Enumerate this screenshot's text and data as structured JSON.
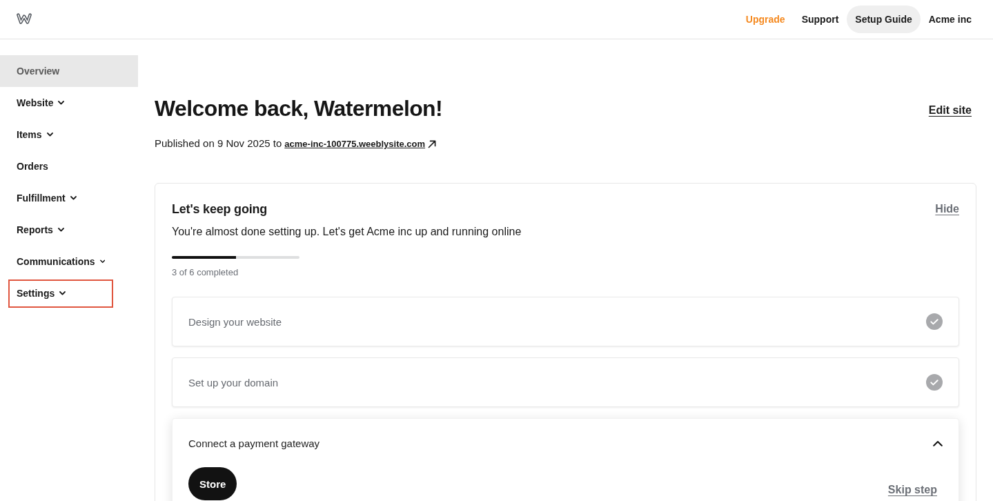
{
  "header": {
    "nav": [
      {
        "label": "Upgrade",
        "kind": "upgrade"
      },
      {
        "label": "Support",
        "kind": "plain"
      },
      {
        "label": "Setup Guide",
        "kind": "pill"
      },
      {
        "label": "Acme inc",
        "kind": "account"
      }
    ]
  },
  "sidebar": {
    "items": [
      {
        "label": "Overview",
        "kind": "link",
        "selected": true,
        "highlighted": false
      },
      {
        "label": "Website",
        "kind": "menu",
        "selected": false,
        "highlighted": false
      },
      {
        "label": "Items",
        "kind": "menu",
        "selected": false,
        "highlighted": false
      },
      {
        "label": "Orders",
        "kind": "link",
        "selected": false,
        "highlighted": false
      },
      {
        "label": "Fulfillment",
        "kind": "menu",
        "selected": false,
        "highlighted": false
      },
      {
        "label": "Reports",
        "kind": "menu",
        "selected": false,
        "highlighted": false
      },
      {
        "label": "Communications",
        "kind": "menu",
        "selected": false,
        "highlighted": false
      },
      {
        "label": "Settings",
        "kind": "menu",
        "selected": false,
        "highlighted": true
      }
    ]
  },
  "main": {
    "title": "Welcome back, Watermelon!",
    "edit_link": "Edit site",
    "published_text": "Published on 9 Nov 2025 to",
    "site_link": "acme-inc-100775.weeblysite.com"
  },
  "setup": {
    "title": "Let's keep going",
    "hide_link": "Hide",
    "subtitle": "You're almost done setting up. Let's get Acme inc up and running online",
    "progress": {
      "level": 0.5,
      "label": "3 of 6 completed"
    },
    "steps": [
      {
        "title": "Design your website",
        "completed": true,
        "expanded": false
      },
      {
        "title": "Set up your domain",
        "completed": true,
        "expanded": false
      },
      {
        "title": "Connect a payment gateway",
        "completed": false,
        "expanded": true,
        "button": "Store",
        "skip_link": "Skip step"
      }
    ]
  }
}
